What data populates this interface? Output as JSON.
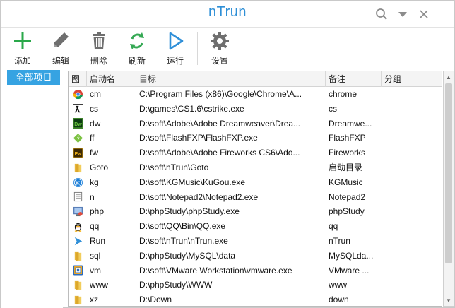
{
  "window": {
    "title": "nTrun"
  },
  "toolbar": {
    "add_label": "添加",
    "edit_label": "编辑",
    "delete_label": "删除",
    "refresh_label": "刷新",
    "run_label": "运行",
    "settings_label": "设置"
  },
  "sidebar": {
    "items": [
      {
        "label": "全部项目",
        "selected": true
      }
    ]
  },
  "table": {
    "columns": [
      "图",
      "启动名",
      "目标",
      "备注",
      "分组"
    ],
    "rows": [
      {
        "icon": "chrome-icon",
        "name": "cm",
        "target": "C:\\Program Files (x86)\\Google\\Chrome\\A...",
        "note": "chrome",
        "group": ""
      },
      {
        "icon": "counterstrike-icon",
        "name": "cs",
        "target": "D:\\games\\CS1.6\\cstrike.exe",
        "note": "cs",
        "group": ""
      },
      {
        "icon": "dreamweaver-icon",
        "name": "dw",
        "target": "D:\\soft\\Adobe\\Adobe Dreamweaver\\Drea...",
        "note": "Dreamwe...",
        "group": ""
      },
      {
        "icon": "flashfxp-icon",
        "name": "ff",
        "target": "D:\\soft\\FlashFXP\\FlashFXP.exe",
        "note": "FlashFXP",
        "group": ""
      },
      {
        "icon": "fireworks-icon",
        "name": "fw",
        "target": "D:\\soft\\Adobe\\Adobe Fireworks CS6\\Ado...",
        "note": "Fireworks",
        "group": ""
      },
      {
        "icon": "folder-icon",
        "name": "Goto",
        "target": "D:\\soft\\nTrun\\Goto",
        "note": "启动目录",
        "group": ""
      },
      {
        "icon": "kugou-icon",
        "name": "kg",
        "target": "D:\\soft\\KGMusic\\KuGou.exe",
        "note": "KGMusic",
        "group": ""
      },
      {
        "icon": "notepad-icon",
        "name": "n",
        "target": "D:\\soft\\Notepad2\\Notepad2.exe",
        "note": "Notepad2",
        "group": ""
      },
      {
        "icon": "phpstudy-icon",
        "name": "php",
        "target": "D:\\phpStudy\\phpStudy.exe",
        "note": "phpStudy",
        "group": ""
      },
      {
        "icon": "qq-icon",
        "name": "qq",
        "target": "D:\\soft\\QQ\\Bin\\QQ.exe",
        "note": "qq",
        "group": ""
      },
      {
        "icon": "ntrun-run-icon",
        "name": "Run",
        "target": "D:\\soft\\nTrun\\nTrun.exe",
        "note": "nTrun",
        "group": ""
      },
      {
        "icon": "folder-icon",
        "name": "sql",
        "target": "D:\\phpStudy\\MySQL\\data",
        "note": "MySQLda...",
        "group": ""
      },
      {
        "icon": "vmware-icon",
        "name": "vm",
        "target": "D:\\soft\\VMware Workstation\\vmware.exe",
        "note": "VMware ...",
        "group": ""
      },
      {
        "icon": "folder-icon",
        "name": "www",
        "target": "D:\\phpStudy\\WWW",
        "note": "www",
        "group": ""
      },
      {
        "icon": "folder-icon",
        "name": "xz",
        "target": "D:\\Down",
        "note": "down",
        "group": ""
      }
    ]
  },
  "colors": {
    "accent": "#2e8fd6",
    "sidebar_selected": "#36a3e2",
    "add_green": "#2aa84a",
    "tool_gray": "#707070",
    "refresh_green": "#34a853",
    "run_blue": "#2f8fd8"
  }
}
